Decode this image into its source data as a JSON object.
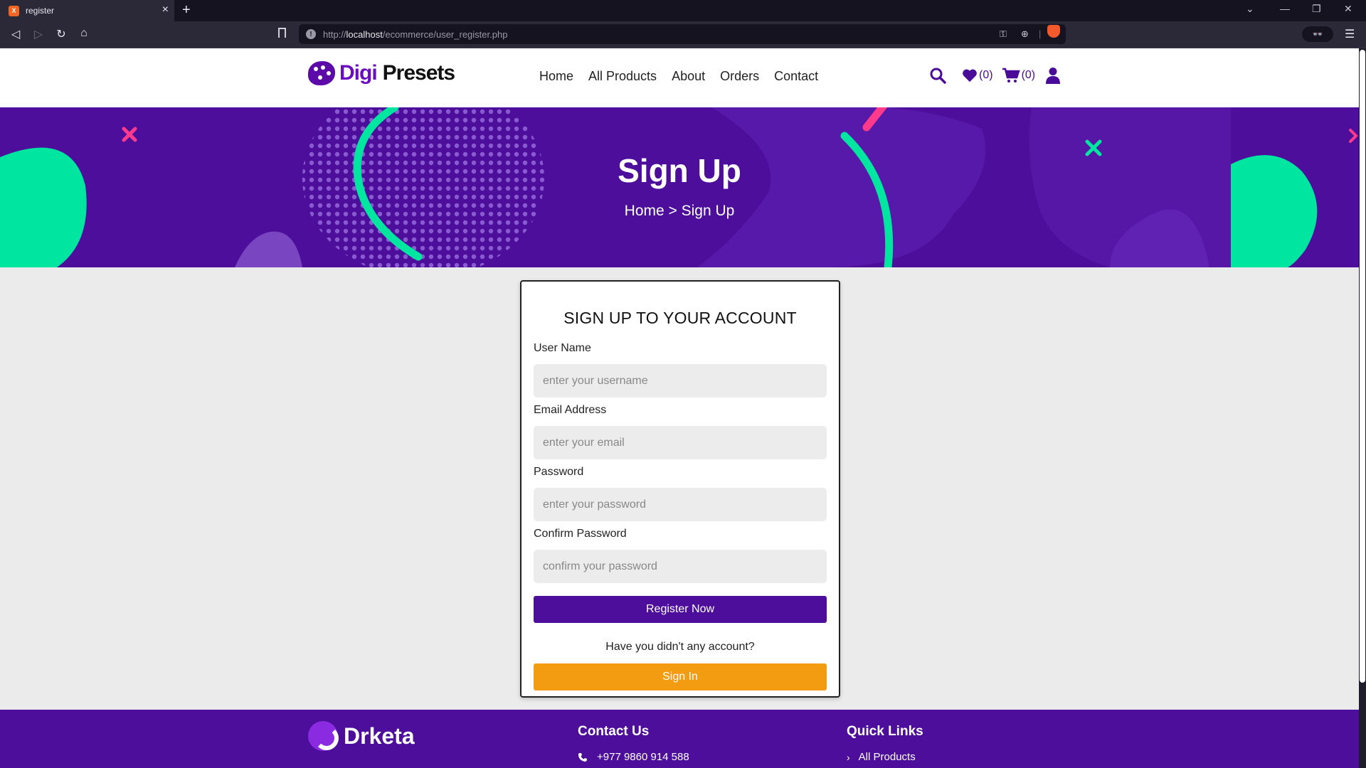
{
  "browser": {
    "tab_title": "register",
    "favicon_label": "X",
    "url_prefix": "http://",
    "url_host": "localhost",
    "url_path": "/ecommerce/user_register.php"
  },
  "header": {
    "logo_part1": "Digi",
    "logo_part2": "Presets",
    "nav": [
      "Home",
      "All Products",
      "About",
      "Orders",
      "Contact"
    ],
    "wishlist_count": "(0)",
    "cart_count": "(0)"
  },
  "hero": {
    "title": "Sign Up",
    "breadcrumb_home": "Home",
    "breadcrumb_sep": " > ",
    "breadcrumb_current": "Sign Up"
  },
  "form": {
    "title": "SIGN UP TO YOUR ACCOUNT",
    "username_label": "User Name",
    "username_placeholder": "enter your username",
    "email_label": "Email Address",
    "email_placeholder": "enter your email",
    "password_label": "Password",
    "password_placeholder": "enter your password",
    "confirm_label": "Confirm Password",
    "confirm_placeholder": "confirm your password",
    "register_label": "Register Now",
    "have_account_text": "Have you didn't any account?",
    "signin_label": "Sign In"
  },
  "footer": {
    "logo_text": "Drketa",
    "contact_heading": "Contact Us",
    "phone": "+977 9860 914 588",
    "links_heading": "Quick Links",
    "link_all_products": "All Products"
  },
  "colors": {
    "brand_purple": "#4d0f9b",
    "accent_orange": "#f39c12",
    "accent_green": "#00e6a0",
    "accent_pink": "#ff3a8c"
  }
}
